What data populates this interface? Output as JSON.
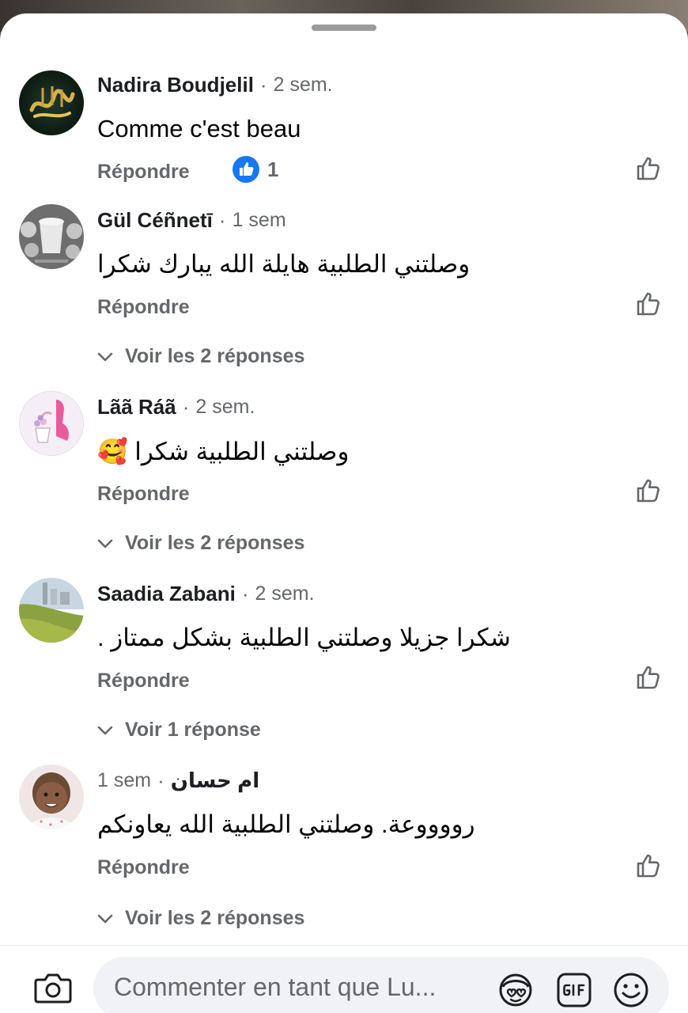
{
  "composer": {
    "placeholder": "Commenter en tant que Lu..."
  },
  "comments": [
    {
      "author": "Nadira Boudjelil",
      "time": "2 sem.",
      "text": "Comme c'est beau",
      "reply_label": "Répondre",
      "reaction_count": "1",
      "reaction_icon": "like-reaction-icon",
      "view_replies": ""
    },
    {
      "author": "Gül Céñnetī",
      "time": "1 sem",
      "text": "وصلتني الطلبية هايلة الله يبارك شكرا",
      "reply_label": "Répondre",
      "view_replies": "Voir les 2 réponses"
    },
    {
      "author": "Lãã Ráã",
      "time": "2 sem.",
      "text": "وصلتني الطلبية شكرا 🥰",
      "reply_label": "Répondre",
      "view_replies": "Voir les 2 réponses"
    },
    {
      "author": "Saadia Zabani",
      "time": "2 sem.",
      "text": "شكرا جزيلا وصلتني الطلبية بشكل ممتاز .",
      "reply_label": "Répondre",
      "view_replies": "Voir 1 réponse"
    },
    {
      "author": "ام حسان",
      "time": "1 sem",
      "text": "رووووعة. وصلتني الطلبية الله يعاونكم",
      "reply_label": "Répondre",
      "view_replies": "Voir les 2 réponses"
    }
  ],
  "colors": {
    "accent": "#1877f2",
    "secondary_text": "#65676b",
    "primary_text": "#050505"
  }
}
